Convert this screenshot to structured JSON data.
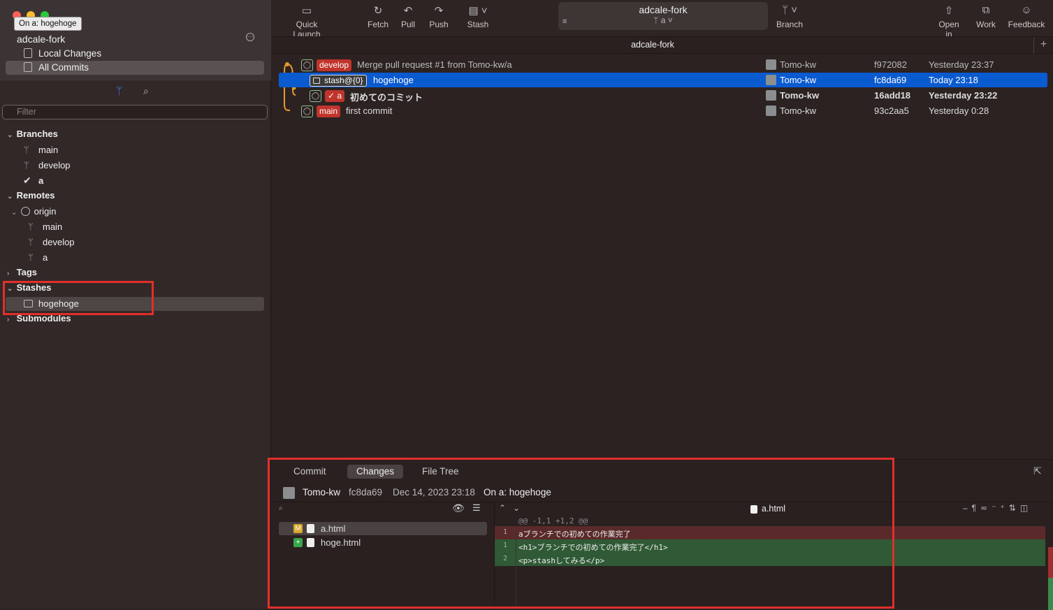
{
  "window": {
    "traffic_lights": [
      "#ff5f57",
      "#febc2e",
      "#28c840"
    ]
  },
  "tooltip": "On a: hogehoge",
  "sidebar": {
    "repo_name": "adcale-fork",
    "nav": [
      {
        "label": "Local Changes"
      },
      {
        "label": "All Commits"
      }
    ],
    "filter_placeholder": "Filter",
    "sections": {
      "branches": "Branches",
      "remotes": "Remotes",
      "tags": "Tags",
      "stashes": "Stashes",
      "submodules": "Submodules"
    },
    "branches": [
      "main",
      "develop",
      "a"
    ],
    "remote_name": "origin",
    "remote_branches": [
      "main",
      "develop",
      "a"
    ],
    "stashes": [
      "hogehoge"
    ]
  },
  "toolbar": {
    "quick_launch": "Quick Launch",
    "fetch": "Fetch",
    "pull": "Pull",
    "push": "Push",
    "stash": "Stash",
    "repo_title": "adcale-fork",
    "current_branch": "a",
    "branch": "Branch",
    "open_in": "Open in",
    "work": "Work",
    "feedback": "Feedback"
  },
  "tab": {
    "title": "adcale-fork",
    "add": "+"
  },
  "commits": [
    {
      "ref": "develop",
      "message": "Merge pull request #1 from Tomo-kw/a",
      "author": "Tomo-kw",
      "hash": "f972082",
      "date": "Yesterday 23:37"
    },
    {
      "ref": "stash@{0}",
      "message": "hogehoge",
      "author": "Tomo-kw",
      "hash": "fc8da69",
      "date": "Today 23:18"
    },
    {
      "ref": "a",
      "message": "初めてのコミット",
      "author": "Tomo-kw",
      "hash": "16add18",
      "date": "Yesterday 23:22"
    },
    {
      "ref": "main",
      "message": "first commit",
      "author": "Tomo-kw",
      "hash": "93c2aa5",
      "date": "Yesterday 0:28"
    }
  ],
  "detail": {
    "tabs": [
      "Commit",
      "Changes",
      "File Tree"
    ],
    "author": "Tomo-kw",
    "hash": "fc8da69",
    "date": "Dec 14, 2023 23:18",
    "subject": "On a: hogehoge",
    "files": [
      {
        "badge": "M",
        "name": "a.html"
      },
      {
        "badge": "+",
        "name": "hoge.html"
      }
    ],
    "diff_file": "a.html",
    "hunk": "@@ -1,1 +1,2 @@",
    "lines": [
      {
        "num": "1",
        "text": "aブランチでの初めての作業完了",
        "kind": "del"
      },
      {
        "num": "1",
        "text": "<h1>ブランチでの初めての作業完了</h1>",
        "kind": "add"
      },
      {
        "num": "2",
        "text": "<p>stashしてみる</p>",
        "kind": "add"
      }
    ]
  },
  "colors": {
    "highlight_box": "#e0302a",
    "selection": "#0a5ad0",
    "ref_tag": "#c0342c",
    "diff_del": "#5a2a2a",
    "diff_add": "#2f5a35"
  }
}
